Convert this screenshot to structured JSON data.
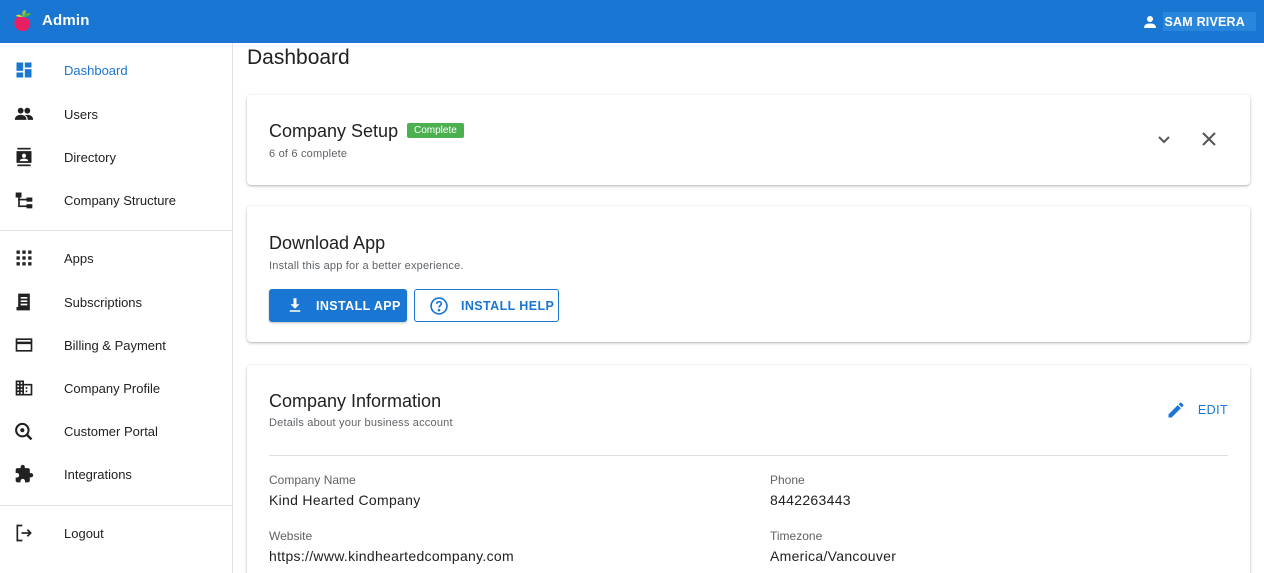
{
  "appbar": {
    "title": "Admin",
    "user_name": "SAM RIVERA",
    "color": "#1976d2"
  },
  "sidebar": {
    "groups": [
      [
        {
          "label": "Dashboard",
          "icon": "dashboard-icon",
          "active": true
        },
        {
          "label": "Users",
          "icon": "users-icon"
        },
        {
          "label": "Directory",
          "icon": "contacts-icon"
        },
        {
          "label": "Company Structure",
          "icon": "org-chart-icon"
        }
      ],
      [
        {
          "label": "Apps",
          "icon": "apps-grid-icon"
        },
        {
          "label": "Subscriptions",
          "icon": "receipt-icon"
        },
        {
          "label": "Billing & Payment",
          "icon": "credit-card-icon"
        },
        {
          "label": "Company Profile",
          "icon": "building-icon"
        },
        {
          "label": "Customer Portal",
          "icon": "portal-search-icon"
        },
        {
          "label": "Integrations",
          "icon": "puzzle-icon"
        }
      ],
      [
        {
          "label": "Logout",
          "icon": "logout-icon"
        }
      ]
    ]
  },
  "main": {
    "page_title": "Dashboard",
    "setup": {
      "title": "Company Setup",
      "badge": "Complete",
      "badge_color": "#4caf50",
      "progress": "6 of 6 complete"
    },
    "download": {
      "title": "Download App",
      "subtitle": "Install this app for a better experience.",
      "install_label": "INSTALL APP",
      "help_label": "INSTALL HELP"
    },
    "company_info": {
      "title": "Company Information",
      "subtitle": "Details about your business account",
      "edit_label": "EDIT",
      "fields": {
        "company_name": {
          "label": "Company Name",
          "value": "Kind Hearted Company"
        },
        "phone": {
          "label": "Phone",
          "value": "8442263443"
        },
        "website": {
          "label": "Website",
          "value": "https://www.kindheartedcompany.com"
        },
        "timezone": {
          "label": "Timezone",
          "value": "America/Vancouver"
        }
      }
    }
  }
}
